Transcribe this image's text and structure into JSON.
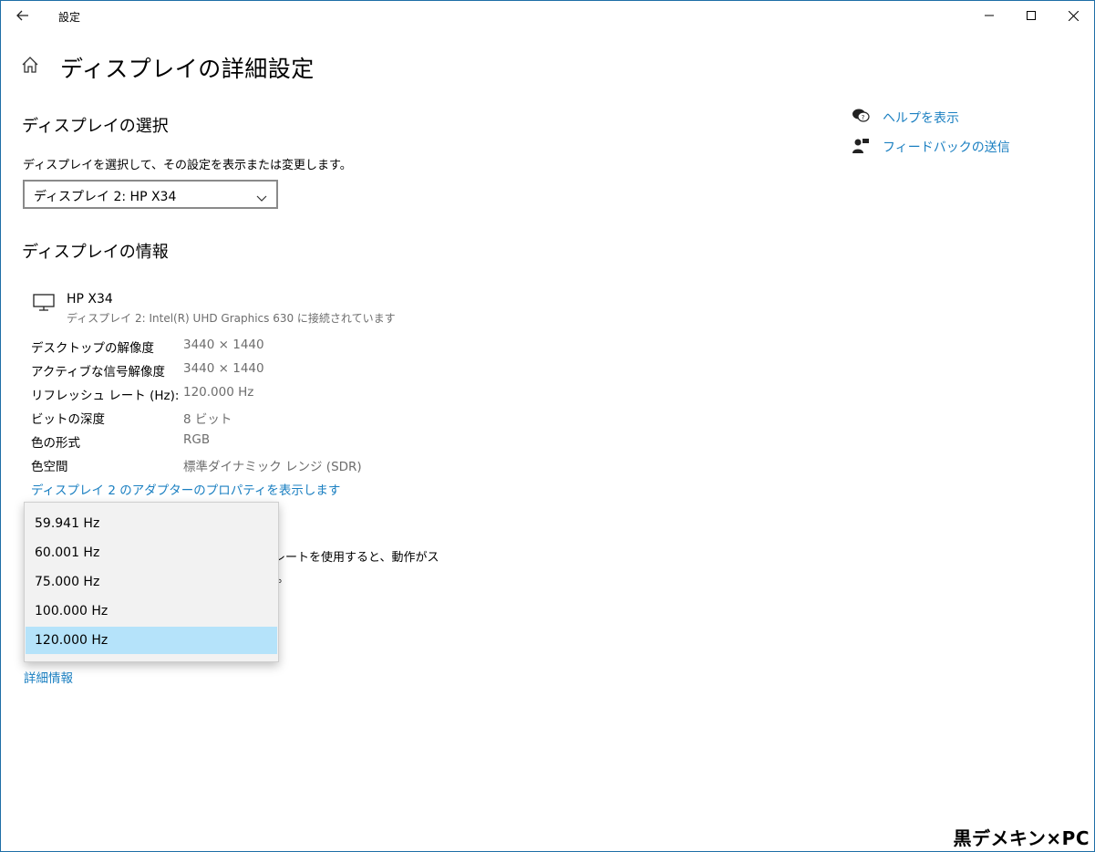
{
  "window": {
    "app_title": "設定"
  },
  "page": {
    "title": "ディスプレイの詳細設定"
  },
  "select_section": {
    "heading": "ディスプレイの選択",
    "description": "ディスプレイを選択して、その設定を表示または変更します。",
    "selected_display": "ディスプレイ 2: HP X34"
  },
  "info_section": {
    "heading": "ディスプレイの情報",
    "monitor_name": "HP X34",
    "monitor_sub": "ディスプレイ 2: Intel(R) UHD Graphics 630 に接続されています",
    "rows": [
      {
        "label": "デスクトップの解像度",
        "value": "3440 × 1440"
      },
      {
        "label": "アクティブな信号解像度",
        "value": "3440 × 1440"
      },
      {
        "label": "リフレッシュ レート (Hz):",
        "value": "120.000 Hz"
      },
      {
        "label": "ビットの深度",
        "value": "8 ビット"
      },
      {
        "label": "色の形式",
        "value": "RGB"
      },
      {
        "label": "色空間",
        "value": "標準ダイナミック レンジ (SDR)"
      }
    ],
    "adapter_link": "ディスプレイ 2 のアダプターのプロパティを表示します"
  },
  "refresh_section": {
    "partial_line1": "レートを使用すると、動作がス",
    "partial_line2": "。"
  },
  "more_info_link": "詳細情報",
  "side_links": {
    "help": "ヘルプを表示",
    "feedback": "フィードバックの送信"
  },
  "refresh_dropdown": {
    "options": [
      "59.941 Hz",
      "60.001 Hz",
      "75.000 Hz",
      "100.000 Hz",
      "120.000 Hz"
    ],
    "selected": "120.000 Hz"
  },
  "watermark": "黒デメキン×PC",
  "icons": {
    "back": "back-arrow-icon",
    "home": "home-icon",
    "monitor": "monitor-icon",
    "help": "help-chat-icon",
    "feedback": "feedback-person-icon"
  },
  "colors": {
    "accent_link": "#1a7fc1",
    "dropdown_selected": "#b5e3fa",
    "frame_border": "#1e6ea7"
  }
}
